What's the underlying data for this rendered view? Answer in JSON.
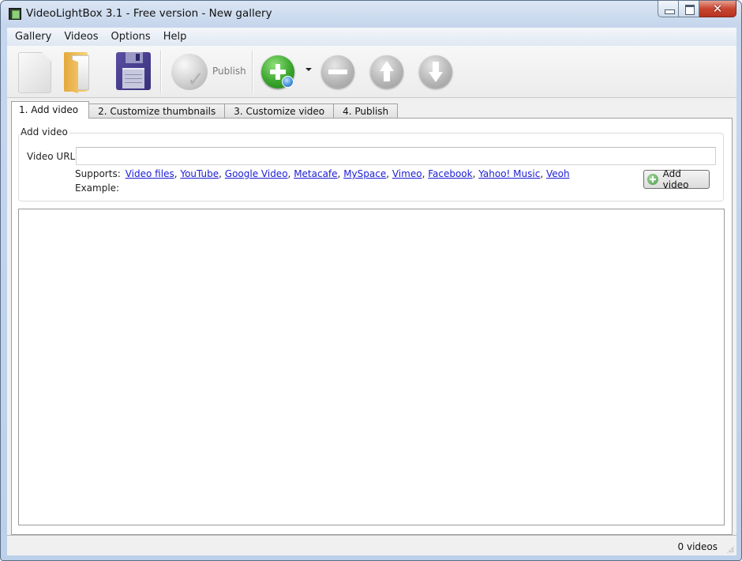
{
  "window": {
    "title": "VideoLightBox 3.1 - Free version - New gallery",
    "controls": {
      "minimize": "minimize",
      "maximize": "maximize",
      "close": "✕"
    }
  },
  "menubar": {
    "items": [
      {
        "label": "Gallery"
      },
      {
        "label": "Videos"
      },
      {
        "label": "Options"
      },
      {
        "label": "Help"
      }
    ]
  },
  "toolbar": {
    "buttons": [
      {
        "name": "new",
        "icon": "new-document-icon",
        "enabled": false
      },
      {
        "name": "open",
        "icon": "open-folder-icon",
        "enabled": true
      },
      {
        "name": "save",
        "icon": "floppy-disk-icon",
        "enabled": true
      },
      {
        "name": "publish",
        "icon": "globe-publish-icon",
        "label": "Publish",
        "enabled": false
      },
      {
        "name": "add",
        "icon": "add-plus-icon",
        "enabled": true,
        "has_dropdown": true
      },
      {
        "name": "remove",
        "icon": "remove-minus-icon",
        "enabled": false
      },
      {
        "name": "move-up",
        "icon": "arrow-up-icon",
        "enabled": false
      },
      {
        "name": "move-down",
        "icon": "arrow-down-icon",
        "enabled": false
      }
    ],
    "publish_label": "Publish"
  },
  "tabs": [
    {
      "label": "1. Add video",
      "active": true
    },
    {
      "label": "2. Customize thumbnails",
      "active": false
    },
    {
      "label": "3. Customize video",
      "active": false
    },
    {
      "label": "4. Publish",
      "active": false
    }
  ],
  "add_video_panel": {
    "group_title": "Add video",
    "url_label": "Video URL",
    "url_value": "",
    "url_placeholder": "",
    "supports_label": "Supports:",
    "supported_sources": [
      "Video files",
      "YouTube",
      "Google Video",
      "Metacafe",
      "MySpace",
      "Vimeo",
      "Facebook",
      "Yahoo! Music",
      "Veoh"
    ],
    "example_label": "Example:",
    "add_button_label": "Add video"
  },
  "video_list": {
    "items": []
  },
  "statusbar": {
    "count_text": "0 videos"
  },
  "colors": {
    "link": "#1c1cd4",
    "close_button": "#c74631",
    "add_green": "#3aa52d"
  }
}
